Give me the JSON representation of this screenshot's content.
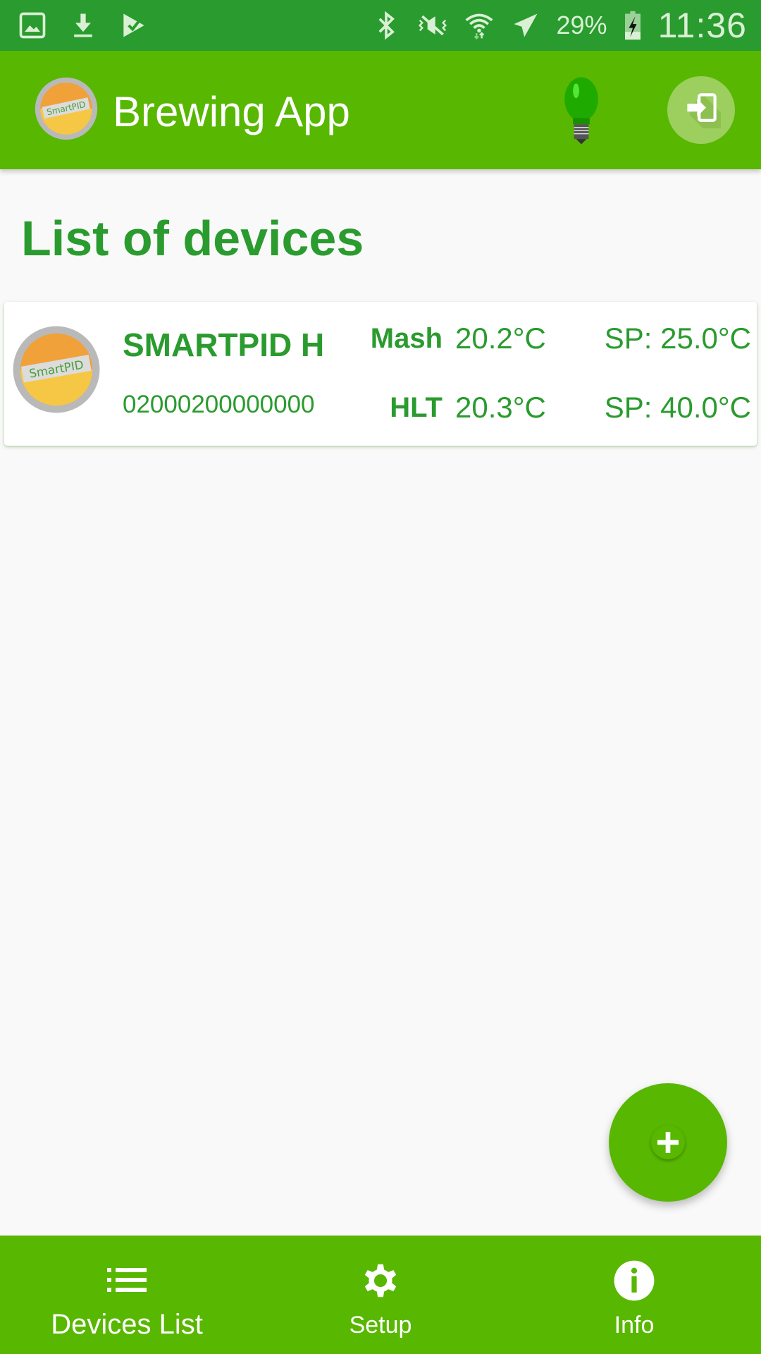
{
  "status_bar": {
    "left_icons": [
      "gallery-icon",
      "download-icon",
      "play-store-check-icon"
    ],
    "right_icons": [
      "bluetooth-icon",
      "vibrate-mute-icon",
      "wifi-icon",
      "airplane-mode-icon"
    ],
    "battery_percent": "29%",
    "battery_level": 0.29,
    "battery_charging": true,
    "time": "11:36"
  },
  "app_bar": {
    "title": "Brewing App",
    "logo_icon": "smartpid-bottlecap-logo",
    "actions": [
      {
        "name": "light-bulb-icon",
        "color": "#1faa00"
      },
      {
        "name": "login-icon"
      }
    ]
  },
  "page": {
    "title": "List of devices"
  },
  "devices": [
    {
      "name": "SMARTPID H",
      "id": "02000200000000",
      "readings": [
        {
          "label": "Mash",
          "value": "20.2°C",
          "setpoint": "SP: 25.0°C"
        },
        {
          "label": "HLT",
          "value": "20.3°C",
          "setpoint": "SP: 40.0°C"
        }
      ]
    }
  ],
  "fab": {
    "icon": "plus-icon",
    "action": "add-device"
  },
  "bottom_nav": {
    "items": [
      {
        "label": "Devices List",
        "icon": "list-icon",
        "active": true
      },
      {
        "label": "Setup",
        "icon": "gear-icon",
        "active": false
      },
      {
        "label": "Info",
        "icon": "info-icon",
        "active": false
      }
    ]
  },
  "colors": {
    "status_bar": "#2a9b2e",
    "primary": "#58b700",
    "text_accent": "#2a9b2e",
    "background": "#f9f9f9"
  }
}
